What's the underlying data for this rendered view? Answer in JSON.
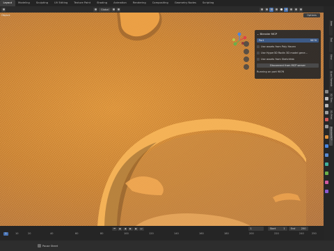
{
  "workspaces": [
    "Layout",
    "Modeling",
    "Sculpting",
    "UV Editing",
    "Texture Paint",
    "Shading",
    "Animation",
    "Rendering",
    "Compositing",
    "Geometry Nodes",
    "Scripting"
  ],
  "active_workspace": "Layout",
  "header": {
    "orientation": "Global",
    "options_label": "Options"
  },
  "viewport": {
    "object_label": "Object"
  },
  "npanel": {
    "title": "Blender MCP",
    "port_label": "Port",
    "port_value": "9876",
    "checkbox_polyhaven": "Use assets from Poly Haven",
    "checkbox_hyper3d": "Use Hyper3D Rodin 3D model gene...",
    "checkbox_sketchfab": "Use assets from Sketchfab",
    "disconnect_button": "Disconnect from MCP server",
    "status_text": "Running on port 9876"
  },
  "sidebar_tabs": [
    "Item",
    "Tool",
    "View",
    "Quad Remesh",
    "3D Tiles",
    "3D-Print",
    "BlenderMCP"
  ],
  "timeline": {
    "current_frame": "1",
    "start_label": "Start",
    "start_value": "1",
    "end_label": "End",
    "end_value": "250",
    "ruler_ticks": [
      "10",
      "20",
      "40",
      "60",
      "80",
      "100",
      "120",
      "140",
      "160",
      "180",
      "200",
      "220",
      "240",
      "250"
    ]
  },
  "statusbar": {
    "left_text": "Pause Sheet"
  },
  "colors": {
    "accent": "#4772b3",
    "mesh_orange": "#e09040",
    "panel_bg": "#282828"
  }
}
